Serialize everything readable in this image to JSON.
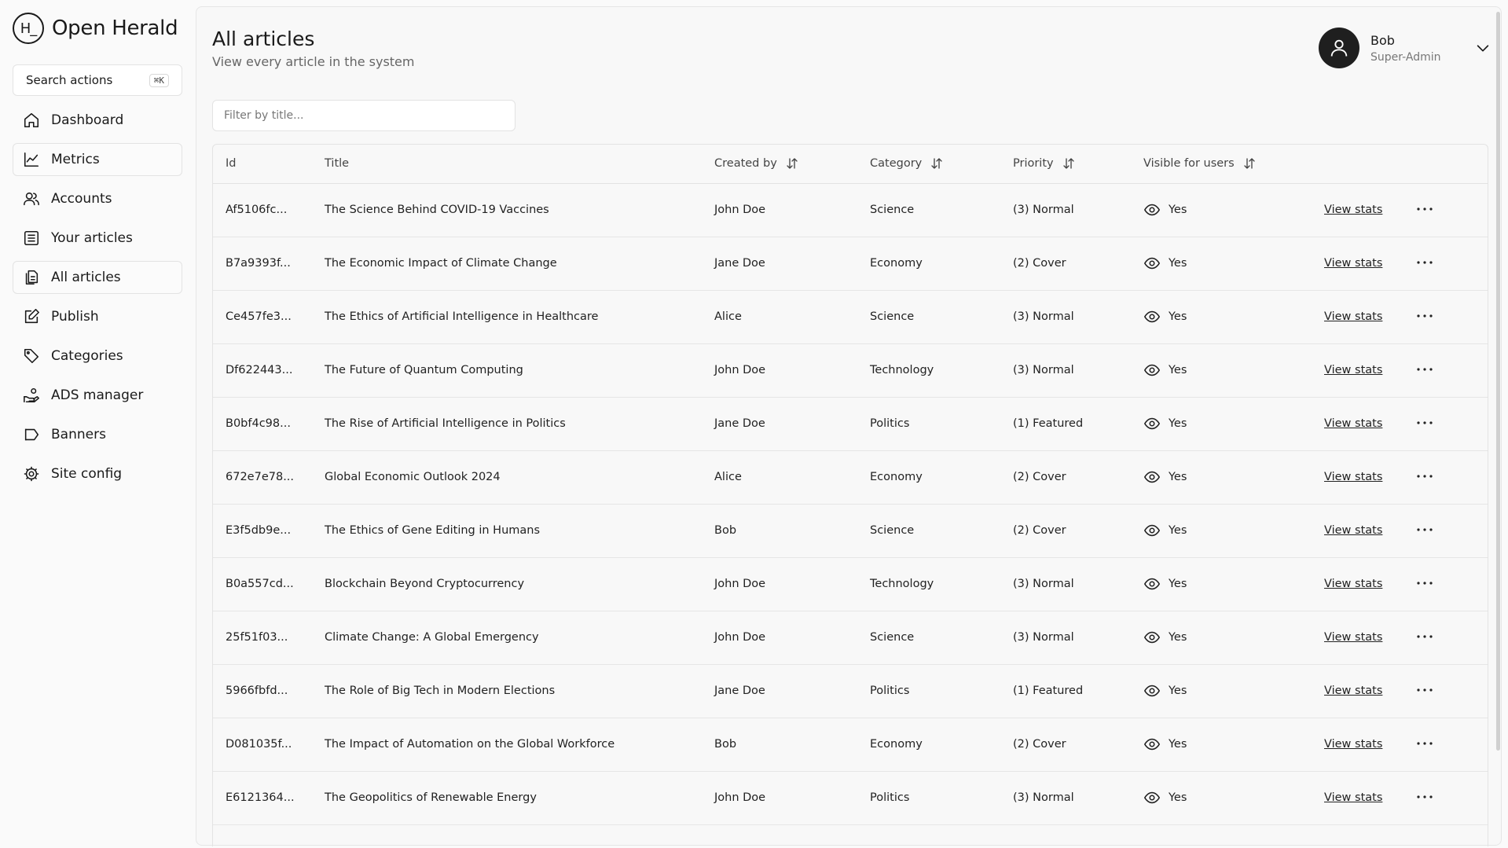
{
  "brand": {
    "logo_mark": "H_",
    "name": "Open Herald"
  },
  "sidebar": {
    "search_label": "Search actions",
    "search_shortcut": "⌘K",
    "items": [
      {
        "label": "Dashboard",
        "icon": "home-icon"
      },
      {
        "label": "Metrics",
        "icon": "chart-line-icon"
      },
      {
        "label": "Accounts",
        "icon": "users-icon"
      },
      {
        "label": "Your articles",
        "icon": "list-icon"
      },
      {
        "label": "All articles",
        "icon": "files-icon"
      },
      {
        "label": "Publish",
        "icon": "edit-icon"
      },
      {
        "label": "Categories",
        "icon": "tag-icon"
      },
      {
        "label": "ADS manager",
        "icon": "hand-coins-icon"
      },
      {
        "label": "Banners",
        "icon": "megaphone-icon"
      },
      {
        "label": "Site config",
        "icon": "gear-icon"
      }
    ]
  },
  "header": {
    "title": "All articles",
    "subtitle": "View every article in the system"
  },
  "user": {
    "name": "Bob",
    "role": "Super-Admin"
  },
  "filter": {
    "placeholder": "Filter by title..."
  },
  "table": {
    "columns": [
      "Id",
      "Title",
      "Created by",
      "Category",
      "Priority",
      "Visible for users"
    ],
    "stats_label": "View stats",
    "rows": [
      {
        "id": "Af5106fc...",
        "title": "The Science Behind COVID-19 Vaccines",
        "created_by": "John Doe",
        "category": "Science",
        "priority": "(3) Normal",
        "visible": "Yes"
      },
      {
        "id": "B7a9393f...",
        "title": "The Economic Impact of Climate Change",
        "created_by": "Jane Doe",
        "category": "Economy",
        "priority": "(2) Cover",
        "visible": "Yes"
      },
      {
        "id": "Ce457fe3...",
        "title": "The Ethics of Artificial Intelligence in Healthcare",
        "created_by": "Alice",
        "category": "Science",
        "priority": "(3) Normal",
        "visible": "Yes"
      },
      {
        "id": "Df622443...",
        "title": "The Future of Quantum Computing",
        "created_by": "John Doe",
        "category": "Technology",
        "priority": "(3) Normal",
        "visible": "Yes"
      },
      {
        "id": "B0bf4c98...",
        "title": "The Rise of Artificial Intelligence in Politics",
        "created_by": "Jane Doe",
        "category": "Politics",
        "priority": "(1) Featured",
        "visible": "Yes"
      },
      {
        "id": "672e7e78...",
        "title": "Global Economic Outlook 2024",
        "created_by": "Alice",
        "category": "Economy",
        "priority": "(2) Cover",
        "visible": "Yes"
      },
      {
        "id": "E3f5db9e...",
        "title": "The Ethics of Gene Editing in Humans",
        "created_by": "Bob",
        "category": "Science",
        "priority": "(2) Cover",
        "visible": "Yes"
      },
      {
        "id": "B0a557cd...",
        "title": "Blockchain Beyond Cryptocurrency",
        "created_by": "John Doe",
        "category": "Technology",
        "priority": "(3) Normal",
        "visible": "Yes"
      },
      {
        "id": "25f51f03...",
        "title": "Climate Change: A Global Emergency",
        "created_by": "John Doe",
        "category": "Science",
        "priority": "(3) Normal",
        "visible": "Yes"
      },
      {
        "id": "5966fbfd...",
        "title": "The Role of Big Tech in Modern Elections",
        "created_by": "Jane Doe",
        "category": "Politics",
        "priority": "(1) Featured",
        "visible": "Yes"
      },
      {
        "id": "D081035f...",
        "title": "The Impact of Automation on the Global Workforce",
        "created_by": "Bob",
        "category": "Economy",
        "priority": "(2) Cover",
        "visible": "Yes"
      },
      {
        "id": "E6121364...",
        "title": "The Geopolitics of Renewable Energy",
        "created_by": "John Doe",
        "category": "Politics",
        "priority": "(3) Normal",
        "visible": "Yes"
      }
    ]
  }
}
